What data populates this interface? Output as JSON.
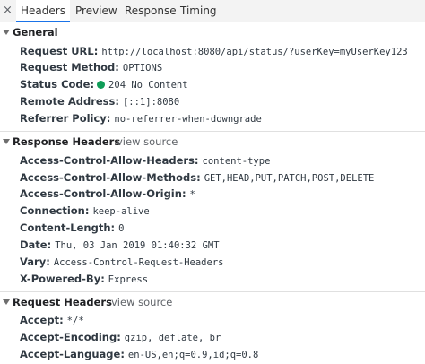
{
  "tabs": [
    {
      "label": "Headers",
      "active": true
    },
    {
      "label": "Preview",
      "active": false
    },
    {
      "label": "Response",
      "active": false
    },
    {
      "label": "Timing",
      "active": false
    }
  ],
  "close_glyph": "×",
  "general": {
    "title": "General",
    "rows": [
      {
        "key": "Request URL:",
        "value": "http://localhost:8080/api/status/?userKey=myUserKey123"
      },
      {
        "key": "Request Method:",
        "value": "OPTIONS"
      },
      {
        "key": "Status Code:",
        "value": "204 No Content",
        "status_color": "#0f9d58"
      },
      {
        "key": "Remote Address:",
        "value": "[::1]:8080"
      },
      {
        "key": "Referrer Policy:",
        "value": "no-referrer-when-downgrade"
      }
    ]
  },
  "response_headers": {
    "title": "Response Headers",
    "view_source": "view source",
    "rows": [
      {
        "key": "Access-Control-Allow-Headers:",
        "value": "content-type"
      },
      {
        "key": "Access-Control-Allow-Methods:",
        "value": "GET,HEAD,PUT,PATCH,POST,DELETE"
      },
      {
        "key": "Access-Control-Allow-Origin:",
        "value": "*"
      },
      {
        "key": "Connection:",
        "value": "keep-alive"
      },
      {
        "key": "Content-Length:",
        "value": "0"
      },
      {
        "key": "Date:",
        "value": "Thu, 03 Jan 2019 01:40:32 GMT"
      },
      {
        "key": "Vary:",
        "value": "Access-Control-Request-Headers"
      },
      {
        "key": "X-Powered-By:",
        "value": "Express"
      }
    ]
  },
  "request_headers": {
    "title": "Request Headers",
    "view_source": "view source",
    "rows": [
      {
        "key": "Accept:",
        "value": "*/*"
      },
      {
        "key": "Accept-Encoding:",
        "value": "gzip, deflate, br"
      },
      {
        "key": "Accept-Language:",
        "value": "en-US,en;q=0.9,id;q=0.8"
      }
    ]
  }
}
